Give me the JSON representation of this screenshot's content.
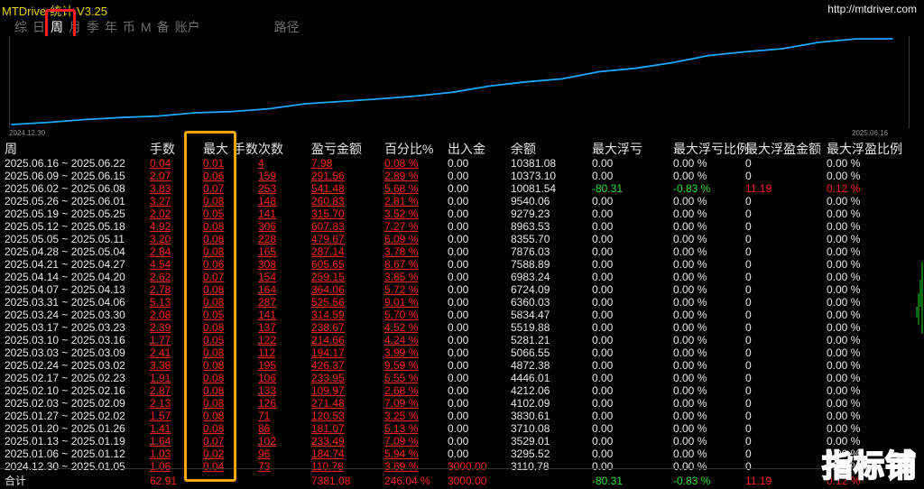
{
  "app": {
    "title": "MTDriver统计 V3.25",
    "site": "http://mtdriver.com"
  },
  "tabs": [
    {
      "label": "综",
      "active": false
    },
    {
      "label": "日",
      "active": false
    },
    {
      "label": "周",
      "active": true
    },
    {
      "label": "月",
      "active": false
    },
    {
      "label": "季",
      "active": false
    },
    {
      "label": "年",
      "active": false
    },
    {
      "label": "币",
      "active": false
    },
    {
      "label": "M",
      "active": false
    },
    {
      "label": "备",
      "active": false
    },
    {
      "label": "账户",
      "active": false
    },
    {
      "label": "路径",
      "active": false
    }
  ],
  "chart": {
    "start_label": "2024.12.30",
    "end_label": "2025.06.16",
    "line_color": "#1ea7ff",
    "x": [
      "2024.12.30",
      "2025.01.06",
      "2025.01.13",
      "2025.01.20",
      "2025.01.27",
      "2025.02.03",
      "2025.02.10",
      "2025.02.17",
      "2025.02.24",
      "2025.03.03",
      "2025.03.10",
      "2025.03.17",
      "2025.03.24",
      "2025.03.31",
      "2025.04.07",
      "2025.04.14",
      "2025.04.21",
      "2025.04.28",
      "2025.05.05",
      "2025.05.12",
      "2025.05.19",
      "2025.05.26",
      "2025.06.02",
      "2025.06.09",
      "2025.06.16"
    ],
    "balance": [
      3110.78,
      3295.52,
      3529.01,
      3710.08,
      3830.61,
      4102.09,
      4212.06,
      4446.01,
      4872.38,
      5066.55,
      5281.21,
      5519.88,
      5834.47,
      6360.03,
      6724.09,
      6983.24,
      7588.89,
      7876.03,
      8355.7,
      8963.53,
      9279.23,
      9540.06,
      10081.54,
      10373.1,
      10381.08
    ]
  },
  "table": {
    "headers": {
      "week": "周",
      "lots": "手数",
      "max": "最大",
      "trades": "手数次数",
      "pnl": "盈亏金额",
      "pct": "百分比%",
      "io": "出入金",
      "balance": "余额",
      "max_dd": "最大浮亏",
      "max_dd_pct": "最大浮亏比例",
      "max_fp": "最大浮盈金额",
      "max_fp_pct": "最大浮盈比例"
    },
    "rows": [
      {
        "week": "2025.06.16 ~ 2025.06.22",
        "lots": "0.04",
        "max": "0.01",
        "trades": "4",
        "pnl": "7.98",
        "pct": "0.08 %",
        "io": "0.00",
        "balance": "10381.08",
        "dd": "0.00",
        "dd_pct": "0.00 %",
        "fp": "0",
        "fp_pct": "0.00 %"
      },
      {
        "week": "2025.06.09 ~ 2025.06.15",
        "lots": "2.07",
        "max": "0.06",
        "trades": "159",
        "pnl": "291.56",
        "pct": "2.89 %",
        "io": "0.00",
        "balance": "10373.10",
        "dd": "0.00",
        "dd_pct": "0.00 %",
        "fp": "0",
        "fp_pct": "0.00 %"
      },
      {
        "week": "2025.06.02 ~ 2025.06.08",
        "lots": "3.83",
        "max": "0.07",
        "trades": "253",
        "pnl": "541.48",
        "pct": "5.68 %",
        "io": "0.00",
        "balance": "10081.54",
        "dd": "-80.31",
        "dd_pct": "-0.83 %",
        "fp": "11.19",
        "fp_pct": "0.12 %"
      },
      {
        "week": "2025.05.26 ~ 2025.06.01",
        "lots": "3.27",
        "max": "0.08",
        "trades": "148",
        "pnl": "260.83",
        "pct": "2.81 %",
        "io": "0.00",
        "balance": "9540.06",
        "dd": "0.00",
        "dd_pct": "0.00 %",
        "fp": "0",
        "fp_pct": "0.00 %"
      },
      {
        "week": "2025.05.19 ~ 2025.05.25",
        "lots": "2.02",
        "max": "0.05",
        "trades": "141",
        "pnl": "315.70",
        "pct": "3.52 %",
        "io": "0.00",
        "balance": "9279.23",
        "dd": "0.00",
        "dd_pct": "0.00 %",
        "fp": "0",
        "fp_pct": "0.00 %"
      },
      {
        "week": "2025.05.12 ~ 2025.05.18",
        "lots": "4.92",
        "max": "0.08",
        "trades": "306",
        "pnl": "607.83",
        "pct": "7.27 %",
        "io": "0.00",
        "balance": "8963.53",
        "dd": "0.00",
        "dd_pct": "0.00 %",
        "fp": "0",
        "fp_pct": "0.00 %"
      },
      {
        "week": "2025.05.05 ~ 2025.05.11",
        "lots": "3.20",
        "max": "0.08",
        "trades": "228",
        "pnl": "479.67",
        "pct": "6.09 %",
        "io": "0.00",
        "balance": "8355.70",
        "dd": "0.00",
        "dd_pct": "0.00 %",
        "fp": "0",
        "fp_pct": "0.00 %"
      },
      {
        "week": "2025.04.28 ~ 2025.05.04",
        "lots": "2.84",
        "max": "0.08",
        "trades": "165",
        "pnl": "287.14",
        "pct": "3.78 %",
        "io": "0.00",
        "balance": "7876.03",
        "dd": "0.00",
        "dd_pct": "0.00 %",
        "fp": "0",
        "fp_pct": "0.00 %"
      },
      {
        "week": "2025.04.21 ~ 2025.04.27",
        "lots": "4.54",
        "max": "0.06",
        "trades": "308",
        "pnl": "605.65",
        "pct": "8.67 %",
        "io": "0.00",
        "balance": "7588.89",
        "dd": "0.00",
        "dd_pct": "0.00 %",
        "fp": "0",
        "fp_pct": "0.00 %"
      },
      {
        "week": "2025.04.14 ~ 2025.04.20",
        "lots": "2.62",
        "max": "0.07",
        "trades": "154",
        "pnl": "259.15",
        "pct": "3.85 %",
        "io": "0.00",
        "balance": "6983.24",
        "dd": "0.00",
        "dd_pct": "0.00 %",
        "fp": "0",
        "fp_pct": "0.00 %"
      },
      {
        "week": "2025.04.07 ~ 2025.04.13",
        "lots": "2.78",
        "max": "0.08",
        "trades": "164",
        "pnl": "364.06",
        "pct": "5.72 %",
        "io": "0.00",
        "balance": "6724.09",
        "dd": "0.00",
        "dd_pct": "0.00 %",
        "fp": "0",
        "fp_pct": "0.00 %"
      },
      {
        "week": "2025.03.31 ~ 2025.04.06",
        "lots": "5.13",
        "max": "0.08",
        "trades": "287",
        "pnl": "525.56",
        "pct": "9.01 %",
        "io": "0.00",
        "balance": "6360.03",
        "dd": "0.00",
        "dd_pct": "0.00 %",
        "fp": "0",
        "fp_pct": "0.00 %"
      },
      {
        "week": "2025.03.24 ~ 2025.03.30",
        "lots": "2.08",
        "max": "0.05",
        "trades": "141",
        "pnl": "314.59",
        "pct": "5.70 %",
        "io": "0.00",
        "balance": "5834.47",
        "dd": "0.00",
        "dd_pct": "0.00 %",
        "fp": "0",
        "fp_pct": "0.00 %"
      },
      {
        "week": "2025.03.17 ~ 2025.03.23",
        "lots": "2.39",
        "max": "0.08",
        "trades": "137",
        "pnl": "238.67",
        "pct": "4.52 %",
        "io": "0.00",
        "balance": "5519.88",
        "dd": "0.00",
        "dd_pct": "0.00 %",
        "fp": "0",
        "fp_pct": "0.00 %"
      },
      {
        "week": "2025.03.10 ~ 2025.03.16",
        "lots": "1.77",
        "max": "0.05",
        "trades": "122",
        "pnl": "214.66",
        "pct": "4.24 %",
        "io": "0.00",
        "balance": "5281.21",
        "dd": "0.00",
        "dd_pct": "0.00 %",
        "fp": "0",
        "fp_pct": "0.00 %"
      },
      {
        "week": "2025.03.03 ~ 2025.03.09",
        "lots": "2.41",
        "max": "0.08",
        "trades": "112",
        "pnl": "194.17",
        "pct": "3.99 %",
        "io": "0.00",
        "balance": "5066.55",
        "dd": "0.00",
        "dd_pct": "0.00 %",
        "fp": "0",
        "fp_pct": "0.00 %"
      },
      {
        "week": "2025.02.24 ~ 2025.03.02",
        "lots": "3.38",
        "max": "0.08",
        "trades": "195",
        "pnl": "426.37",
        "pct": "9.59 %",
        "io": "0.00",
        "balance": "4872.38",
        "dd": "0.00",
        "dd_pct": "0.00 %",
        "fp": "0",
        "fp_pct": "0.00 %"
      },
      {
        "week": "2025.02.17 ~ 2025.02.23",
        "lots": "1.91",
        "max": "0.08",
        "trades": "106",
        "pnl": "233.95",
        "pct": "5.55 %",
        "io": "0.00",
        "balance": "4446.01",
        "dd": "0.00",
        "dd_pct": "0.00 %",
        "fp": "0",
        "fp_pct": "0.00 %"
      },
      {
        "week": "2025.02.10 ~ 2025.02.16",
        "lots": "2.87",
        "max": "0.08",
        "trades": "133",
        "pnl": "109.97",
        "pct": "2.68 %",
        "io": "0.00",
        "balance": "4212.06",
        "dd": "0.00",
        "dd_pct": "0.00 %",
        "fp": "0",
        "fp_pct": "0.00 %"
      },
      {
        "week": "2025.02.03 ~ 2025.02.09",
        "lots": "2.13",
        "max": "0.08",
        "trades": "126",
        "pnl": "271.48",
        "pct": "7.09 %",
        "io": "0.00",
        "balance": "4102.09",
        "dd": "0.00",
        "dd_pct": "0.00 %",
        "fp": "0",
        "fp_pct": "0.00 %"
      },
      {
        "week": "2025.01.27 ~ 2025.02.02",
        "lots": "1.57",
        "max": "0.08",
        "trades": "71",
        "pnl": "120.53",
        "pct": "3.25 %",
        "io": "0.00",
        "balance": "3830.61",
        "dd": "0.00",
        "dd_pct": "0.00 %",
        "fp": "0",
        "fp_pct": "0.00 %"
      },
      {
        "week": "2025.01.20 ~ 2025.01.26",
        "lots": "1.41",
        "max": "0.08",
        "trades": "86",
        "pnl": "181.07",
        "pct": "5.13 %",
        "io": "0.00",
        "balance": "3710.08",
        "dd": "0.00",
        "dd_pct": "0.00 %",
        "fp": "0",
        "fp_pct": "0.00 %"
      },
      {
        "week": "2025.01.13 ~ 2025.01.19",
        "lots": "1.64",
        "max": "0.07",
        "trades": "102",
        "pnl": "233.49",
        "pct": "7.09 %",
        "io": "0.00",
        "balance": "3529.01",
        "dd": "0.00",
        "dd_pct": "0.00 %",
        "fp": "0",
        "fp_pct": "0.00 %"
      },
      {
        "week": "2025.01.06 ~ 2025.01.12",
        "lots": "1.03",
        "max": "0.02",
        "trades": "96",
        "pnl": "184.74",
        "pct": "5.94 %",
        "io": "0.00",
        "balance": "3295.52",
        "dd": "0.00",
        "dd_pct": "0.00 %",
        "fp": "0",
        "fp_pct": "0.00 %"
      },
      {
        "week": "2024.12.30 ~ 2025.01.05",
        "lots": "1.06",
        "max": "0.04",
        "trades": "73",
        "pnl": "110.78",
        "pct": "3.69 %",
        "io": "3000.00",
        "balance": "3110.78",
        "dd": "0.00",
        "dd_pct": "0.00 %",
        "fp": "0",
        "fp_pct": "0.00 %"
      }
    ],
    "total": {
      "label": "合计",
      "lots": "62.91",
      "pnl": "7381.08",
      "pct": "246.04 %",
      "io": "3000.00",
      "dd": "-80.31",
      "dd_pct": "-0.83 %",
      "fp": "11.19",
      "fp_pct": "0.12 %"
    }
  },
  "watermark": "指标铺",
  "colors": {
    "positive": "#ff1e1e",
    "negative": "#25e033",
    "neutral": "#e8e8e8",
    "title": "#e6d200",
    "tab_highlight": "#ff1a1a",
    "column_highlight": "#f6a800"
  }
}
